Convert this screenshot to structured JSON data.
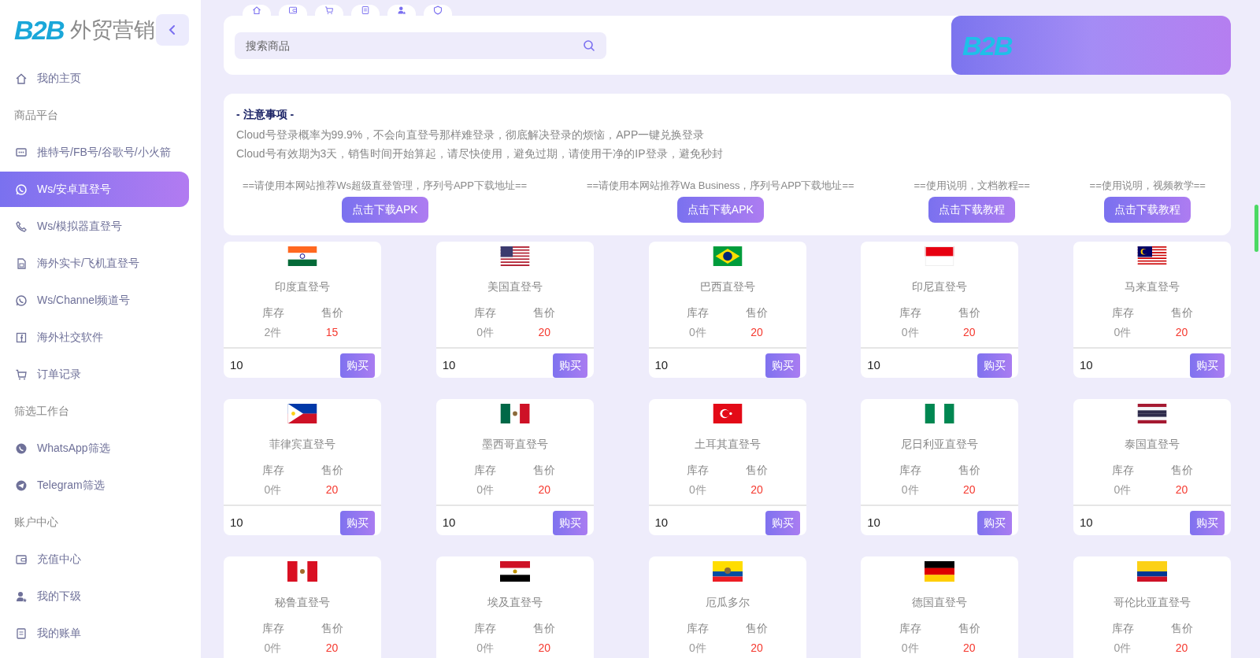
{
  "sidebar": {
    "logo": "B2B",
    "title": "外贸营销",
    "items": [
      {
        "kind": "link",
        "label": "我的主页",
        "selected": false
      },
      {
        "kind": "section",
        "label": "商品平台"
      },
      {
        "kind": "link",
        "label": "推特号/FB号/谷歌号/小火箭",
        "selected": false
      },
      {
        "kind": "link",
        "label": "Ws/安卓直登号",
        "selected": true
      },
      {
        "kind": "link",
        "label": "Ws/模拟器直登号",
        "selected": false
      },
      {
        "kind": "link",
        "label": "海外实卡/飞机直登号",
        "selected": false
      },
      {
        "kind": "link",
        "label": "Ws/Channel频道号",
        "selected": false
      },
      {
        "kind": "link",
        "label": "海外社交软件",
        "selected": false
      },
      {
        "kind": "link",
        "label": "订单记录",
        "selected": false
      },
      {
        "kind": "section",
        "label": "筛选工作台"
      },
      {
        "kind": "link",
        "label": "WhatsApp筛选",
        "selected": false
      },
      {
        "kind": "link",
        "label": "Telegram筛选",
        "selected": false
      },
      {
        "kind": "section",
        "label": "账户中心"
      },
      {
        "kind": "link",
        "label": "充值中心",
        "selected": false
      },
      {
        "kind": "link",
        "label": "我的下级",
        "selected": false
      },
      {
        "kind": "link",
        "label": "我的账单",
        "selected": false
      }
    ]
  },
  "search": {
    "placeholder": "搜索商品"
  },
  "banner": {
    "logo": "B2B"
  },
  "notice": {
    "title": "- 注意事项 -",
    "lines": [
      "Cloud号登录概率为99.9%，不会向直登号那样难登录，彻底解决登录的烦恼，APP一键兑换登录",
      "Cloud号有效期为3天，销售时间开始算起，请尽快使用，避免过期，请使用干净的IP登录，避免秒封"
    ],
    "downloads": [
      {
        "caption": "==请使用本网站推荐Ws超级直登管理，序列号APP下载地址==",
        "button": "点击下载APK"
      },
      {
        "caption": "==请使用本网站推荐Wa Business，序列号APP下载地址==",
        "button": "点击下载APK"
      },
      {
        "caption": "==使用说明，文档教程==",
        "button": "点击下载教程"
      },
      {
        "caption": "==使用说明，视频教学==",
        "button": "点击下载教程"
      }
    ]
  },
  "products": [
    {
      "name": "印度直登号",
      "stock_label": "库存",
      "price_label": "售价",
      "stock": "2件",
      "price": "15",
      "quantity": "10",
      "buy": "购买"
    },
    {
      "name": "美国直登号",
      "stock_label": "库存",
      "price_label": "售价",
      "stock": "0件",
      "price": "20",
      "quantity": "10",
      "buy": "购买"
    },
    {
      "name": "巴西直登号",
      "stock_label": "库存",
      "price_label": "售价",
      "stock": "0件",
      "price": "20",
      "quantity": "10",
      "buy": "购买"
    },
    {
      "name": "印尼直登号",
      "stock_label": "库存",
      "price_label": "售价",
      "stock": "0件",
      "price": "20",
      "quantity": "10",
      "buy": "购买"
    },
    {
      "name": "马来直登号",
      "stock_label": "库存",
      "price_label": "售价",
      "stock": "0件",
      "price": "20",
      "quantity": "10",
      "buy": "购买"
    },
    {
      "name": "菲律宾直登号",
      "stock_label": "库存",
      "price_label": "售价",
      "stock": "0件",
      "price": "20",
      "quantity": "10",
      "buy": "购买"
    },
    {
      "name": "墨西哥直登号",
      "stock_label": "库存",
      "price_label": "售价",
      "stock": "0件",
      "price": "20",
      "quantity": "10",
      "buy": "购买"
    },
    {
      "name": "土耳其直登号",
      "stock_label": "库存",
      "price_label": "售价",
      "stock": "0件",
      "price": "20",
      "quantity": "10",
      "buy": "购买"
    },
    {
      "name": "尼日利亚直登号",
      "stock_label": "库存",
      "price_label": "售价",
      "stock": "0件",
      "price": "20",
      "quantity": "10",
      "buy": "购买"
    },
    {
      "name": "泰国直登号",
      "stock_label": "库存",
      "price_label": "售价",
      "stock": "0件",
      "price": "20",
      "quantity": "10",
      "buy": "购买"
    },
    {
      "name": "秘鲁直登号",
      "stock_label": "库存",
      "price_label": "售价",
      "stock": "0件",
      "price": "20"
    },
    {
      "name": "埃及直登号",
      "stock_label": "库存",
      "price_label": "售价",
      "stock": "0件",
      "price": "20"
    },
    {
      "name": "厄瓜多尔",
      "stock_label": "库存",
      "price_label": "售价",
      "stock": "0件",
      "price": "20"
    },
    {
      "name": "德国直登号",
      "stock_label": "库存",
      "price_label": "售价",
      "stock": "0件",
      "price": "20"
    },
    {
      "name": "哥伦比亚直登号",
      "stock_label": "库存",
      "price_label": "售价",
      "stock": "0件",
      "price": "20"
    }
  ]
}
